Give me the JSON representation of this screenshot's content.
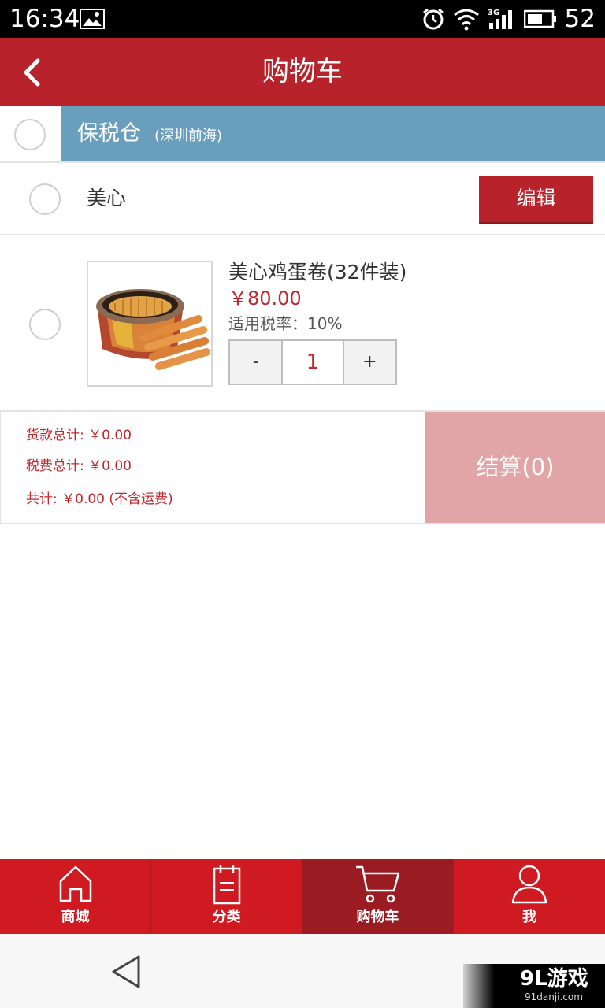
{
  "status_bar": {
    "time": "16:34",
    "battery": "52",
    "icons": [
      "image-icon",
      "alarm-icon",
      "wifi-icon",
      "3g-signal-icon",
      "battery-icon"
    ]
  },
  "header": {
    "title": "购物车",
    "background": "#b8232b"
  },
  "warehouse": {
    "name": "保税仓",
    "location": "(深圳前海)",
    "color": "#699fbc"
  },
  "brand": {
    "name": "美心",
    "edit_label": "编辑"
  },
  "product": {
    "name": "美心鸡蛋卷(32件装)",
    "price": "￥80.00",
    "tax_rate": "适用税率：10%",
    "minus_label": "-",
    "quantity": "1",
    "plus_label": "+"
  },
  "totals": {
    "goods_total": "货款总计: ￥0.00",
    "tax_total": "税费总计: ￥0.00",
    "grand_total": "共计: ￥0.00 (不含运费)",
    "checkout_label": "结算(0)",
    "checkout_color": "#e2a5a7"
  },
  "tabs": [
    {
      "label": "商城",
      "icon": "home-icon",
      "active": false
    },
    {
      "label": "分类",
      "icon": "category-icon",
      "active": false
    },
    {
      "label": "购物车",
      "icon": "cart-icon",
      "active": true
    },
    {
      "label": "我",
      "icon": "user-icon",
      "active": false
    }
  ],
  "watermark": {
    "title": "9L游戏",
    "subtitle": "91danji.com"
  }
}
